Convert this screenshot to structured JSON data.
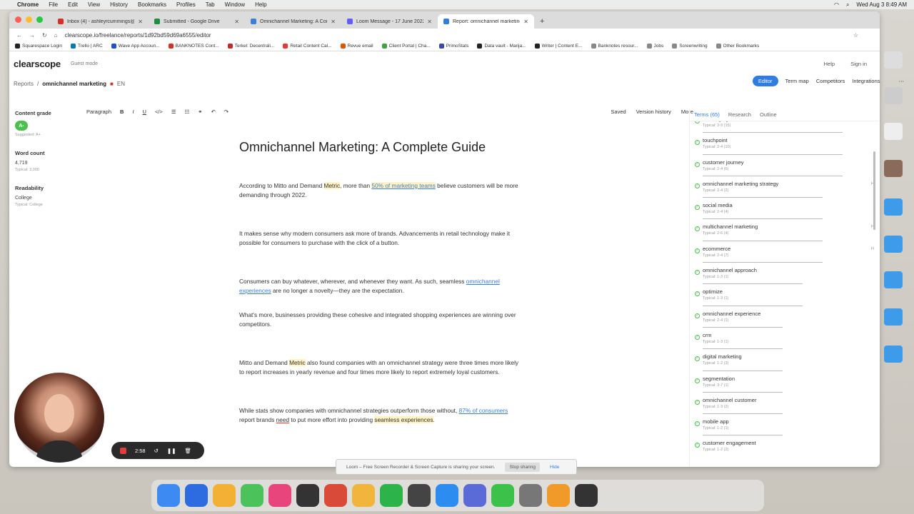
{
  "menubar": {
    "app": "Chrome",
    "items": [
      "File",
      "Edit",
      "View",
      "History",
      "Bookmarks",
      "Profiles",
      "Tab",
      "Window",
      "Help"
    ],
    "clock": "Wed Aug 3  8:49 AM"
  },
  "tabs": [
    {
      "title": "Inbox (4) - ashleyrcummings@",
      "color": "#d93025"
    },
    {
      "title": "Submitted - Google Drive",
      "color": "#1e8e3e"
    },
    {
      "title": "Omnichannel Marketing: A Com",
      "color": "#3c7fd6"
    },
    {
      "title": "Loom Message - 17 June 2022",
      "color": "#625df5"
    },
    {
      "title": "Report: omnichannel marketing",
      "color": "#2f7de1"
    }
  ],
  "url": "clearscope.io/freelance/reports/1d92bd59d69a6555/editor",
  "bookmarks": [
    "Squarespace Login",
    "Trello | ARC",
    "Wave App Accoun...",
    "BANKNOTES Cont...",
    "Terkel: Decentrali...",
    "Retail Content Cal...",
    "Revue email",
    "Client Portal | Cha...",
    "PrimoStats",
    "Data vault - Marija...",
    "Writer | Content E...",
    "Banknotes resour...",
    "Jobs",
    "Screenwriting",
    "Other Bookmarks"
  ],
  "app": {
    "logo": "clearscope",
    "guest": "Guest mode",
    "help": "Help",
    "signin": "Sign in"
  },
  "breadcrumb": {
    "reports": "Reports",
    "sep": "/",
    "report": "omnichannel marketing",
    "lang": "EN"
  },
  "topnav": {
    "editor": "Editor",
    "termmap": "Term map",
    "competitors": "Competitors",
    "integrations": "Integrations"
  },
  "meta": {
    "grade_label": "Content grade",
    "grade": "A-",
    "suggested": "Suggested: A+",
    "wc_label": "Word count",
    "wc": "4,719",
    "wc_typ": "Typical: 3,000",
    "read_label": "Readability",
    "read": "College",
    "read_typ": "Typical: College"
  },
  "toolbar": {
    "paragraph": "Paragraph",
    "saved": "Saved",
    "version": "Version history",
    "more": "More"
  },
  "doc": {
    "title": "Omnichannel Marketing: A Complete Guide",
    "p1a": "According to Mitto and Demand ",
    "p1hl": "Metric",
    ", more than ": "",
    "p1b": ", more than ",
    "p1link": "50% of marketing teams",
    "p1c": " believe customers will be more demanding through 2022.",
    "p2": "It makes sense why modern consumers ask more of brands. Advancements in retail technology make it possible for consumers to purchase with the click of a button.",
    "p3a": "Consumers can buy whatever, wherever, and whenever they want. As such, seamless ",
    "p3link": "omnichannel experiences",
    "p3b": " are no longer a novelty—they are the expectation.",
    "p4": "What's more, businesses providing these cohesive and integrated shopping experiences are winning over competitors.",
    "p5a": "Mitto and Demand ",
    "p5hl": "Metric",
    "p5b": " also found companies with an omnichannel strategy were three times more likely to report increases in yearly revenue and four times more likely to report extremely loyal customers.",
    "p6a": "While stats show companies with omnichannel strategies outperform those without, ",
    "p6link": "87% of consumers",
    "p6b": " report brands ",
    "p6c": "need",
    "p6d": " to put more effort into providing ",
    "p6hl": "seamless experiences",
    "p6e": "."
  },
  "rtabs": {
    "terms": "Terms (65)",
    "research": "Research",
    "outline": "Outline"
  },
  "terms": [
    {
      "name": "messaging",
      "typ": "Typical: 3-9 (15)",
      "bar": 0.7,
      "flag": ""
    },
    {
      "name": "touchpoint",
      "typ": "Typical: 2-4 (10)",
      "bar": 0.7,
      "flag": ""
    },
    {
      "name": "customer journey",
      "typ": "Typical: 2-4 (6)",
      "bar": 0.7,
      "flag": ""
    },
    {
      "name": "omnichannel marketing strategy",
      "typ": "Typical: 2-4 (2)",
      "bar": 0.6,
      "flag": "H"
    },
    {
      "name": "social media",
      "typ": "Typical: 2-4 (4)",
      "bar": 0.6,
      "flag": ""
    },
    {
      "name": "multichannel marketing",
      "typ": "Typical: 2-6 (4)",
      "bar": 0.6,
      "flag": "H"
    },
    {
      "name": "ecommerce",
      "typ": "Typical: 2-4 (7)",
      "bar": 0.6,
      "flag": "H"
    },
    {
      "name": "omnichannel approach",
      "typ": "Typical: 1-3 (1)",
      "bar": 0.5,
      "flag": ""
    },
    {
      "name": "optimize",
      "typ": "Typical: 1-3 (1)",
      "bar": 0.5,
      "flag": ""
    },
    {
      "name": "omnichannel experience",
      "typ": "Typical: 2-4 (1)",
      "bar": 0.4,
      "flag": ""
    },
    {
      "name": "crm",
      "typ": "Typical: 1-3 (1)",
      "bar": 0.4,
      "flag": ""
    },
    {
      "name": "digital marketing",
      "typ": "Typical: 1-2 (3)",
      "bar": 0.4,
      "flag": ""
    },
    {
      "name": "segmentation",
      "typ": "Typical: 3-7 (1)",
      "bar": 0.4,
      "flag": ""
    },
    {
      "name": "omnichannel customer",
      "typ": "Typical: 1-3 (2)",
      "bar": 0.4,
      "flag": ""
    },
    {
      "name": "mobile app",
      "typ": "Typical: 1-2 (1)",
      "bar": 0.4,
      "flag": ""
    },
    {
      "name": "customer engagement",
      "typ": "Typical: 1-2 (2)",
      "bar": 0.4,
      "flag": ""
    }
  ],
  "loom": {
    "time": "2:58",
    "share_text": "Loom – Free Screen Recorder & Screen Capture is sharing your screen.",
    "stop": "Stop sharing",
    "hide": "Hide"
  },
  "dock": [
    "#3d8bf2",
    "#2d6be0",
    "#f2b134",
    "#4cc35a",
    "#e7457b",
    "#333333",
    "#d94a38",
    "#f0b53a",
    "#2cb34a",
    "#444444",
    "#2d8cf0",
    "#5a6bd8",
    "#3cc24a",
    "#777777",
    "#f19a2a",
    "#333333"
  ]
}
